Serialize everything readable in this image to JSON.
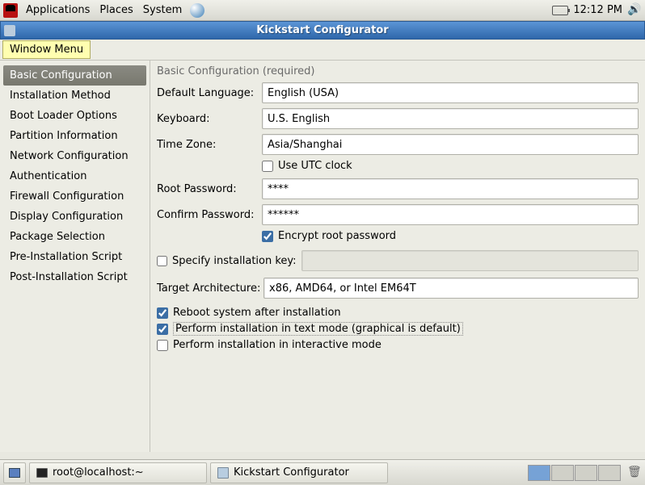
{
  "panel": {
    "menus": {
      "applications": "Applications",
      "places": "Places",
      "system": "System"
    },
    "clock": "12:12 PM"
  },
  "window": {
    "title": "Kickstart Configurator",
    "menu_button": "Window Menu"
  },
  "sidebar": {
    "items": [
      "Basic Configuration",
      "Installation Method",
      "Boot Loader Options",
      "Partition Information",
      "Network Configuration",
      "Authentication",
      "Firewall Configuration",
      "Display Configuration",
      "Package Selection",
      "Pre-Installation Script",
      "Post-Installation Script"
    ]
  },
  "form": {
    "section_title": "Basic Configuration (required)",
    "labels": {
      "default_language": "Default Language:",
      "keyboard": "Keyboard:",
      "time_zone": "Time Zone:",
      "root_password": "Root Password:",
      "confirm_password": "Confirm Password:",
      "target_arch": "Target Architecture:"
    },
    "values": {
      "default_language": "English (USA)",
      "keyboard": "U.S. English",
      "time_zone": "Asia/Shanghai",
      "root_password": "****",
      "confirm_password": "******",
      "target_arch": "x86, AMD64, or Intel EM64T"
    },
    "checkboxes": {
      "use_utc": "Use UTC clock",
      "encrypt_root": "Encrypt root password",
      "specify_key": "Specify installation key:",
      "reboot_after": "Reboot system after installation",
      "text_mode": "Perform installation in text mode (graphical is default)",
      "interactive": "Perform installation in interactive mode"
    },
    "checked": {
      "use_utc": false,
      "encrypt_root": true,
      "specify_key": false,
      "reboot_after": true,
      "text_mode": true,
      "interactive": false
    }
  },
  "taskbar": {
    "item1": "root@localhost:~",
    "item2": "Kickstart Configurator"
  }
}
